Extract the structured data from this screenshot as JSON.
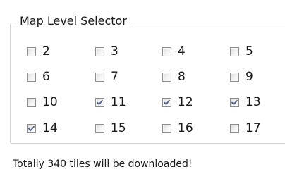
{
  "group": {
    "title": "Map Level Selector"
  },
  "levels": [
    {
      "label": "2",
      "checked": false
    },
    {
      "label": "3",
      "checked": false
    },
    {
      "label": "4",
      "checked": false
    },
    {
      "label": "5",
      "checked": false
    },
    {
      "label": "6",
      "checked": false
    },
    {
      "label": "7",
      "checked": false
    },
    {
      "label": "8",
      "checked": false
    },
    {
      "label": "9",
      "checked": false
    },
    {
      "label": "10",
      "checked": false
    },
    {
      "label": "11",
      "checked": true
    },
    {
      "label": "12",
      "checked": true
    },
    {
      "label": "13",
      "checked": true
    },
    {
      "label": "14",
      "checked": true
    },
    {
      "label": "15",
      "checked": false
    },
    {
      "label": "16",
      "checked": false
    },
    {
      "label": "17",
      "checked": false
    }
  ],
  "status": {
    "text": "Totally 340 tiles will be downloaded!"
  },
  "colors": {
    "checkmark": "#4a5f8c",
    "box_border": "#8e8f8f",
    "group_border": "#d7d7d7"
  }
}
